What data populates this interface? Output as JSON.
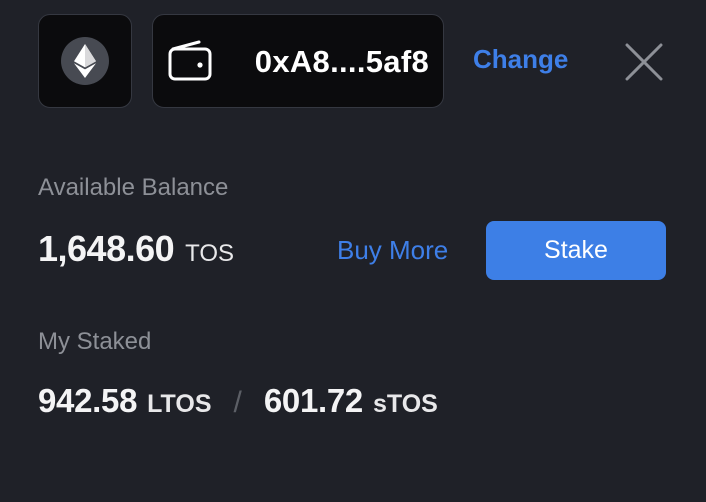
{
  "header": {
    "network_icon": "ethereum-icon",
    "wallet_icon": "wallet-icon",
    "wallet_address": "0xA8....5af8",
    "change_label": "Change",
    "close_icon": "close-icon"
  },
  "balance": {
    "label": "Available Balance",
    "amount": "1,648.60",
    "unit": "TOS",
    "buy_more_label": "Buy More",
    "stake_label": "Stake"
  },
  "staked": {
    "label": "My Staked",
    "ltos_amount": "942.58",
    "ltos_unit": "LTOS",
    "separator": "/",
    "stos_amount": "601.72",
    "stos_unit": "sTOS"
  },
  "colors": {
    "background": "#1f2128",
    "card": "#0b0b0d",
    "accent": "#3d7fe6",
    "muted_text": "#8d9097"
  }
}
